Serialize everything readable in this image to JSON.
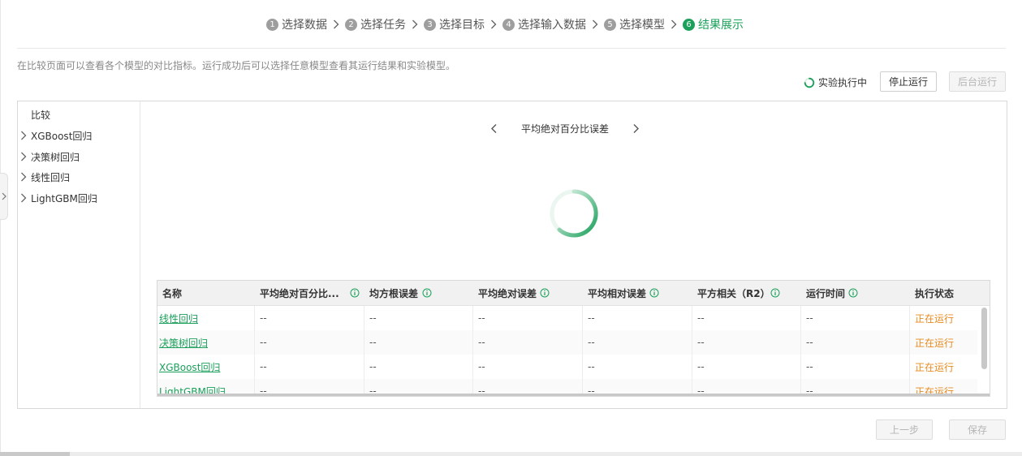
{
  "steps": [
    {
      "num": "1",
      "label": "选择数据"
    },
    {
      "num": "2",
      "label": "选择任务"
    },
    {
      "num": "3",
      "label": "选择目标"
    },
    {
      "num": "4",
      "label": "选择输入数据"
    },
    {
      "num": "5",
      "label": "选择模型"
    },
    {
      "num": "6",
      "label": "结果展示",
      "active": true
    }
  ],
  "hint": "在比较页面可以查看各个模型的对比指标。运行成功后可以选择任意模型查看其运行结果和实验模型。",
  "status": {
    "label": "实验执行中"
  },
  "buttons": {
    "stop": "停止运行",
    "background": "后台运行",
    "prev": "上一步",
    "save": "保存"
  },
  "sidebar": {
    "root": "比较",
    "items": [
      "XGBoost回归",
      "决策树回归",
      "线性回归",
      "LightGBM回归"
    ]
  },
  "metric_nav": {
    "title": "平均绝对百分比误差"
  },
  "table": {
    "columns": [
      "名称",
      "平均绝对百分比...",
      "均方根误差",
      "平均绝对误差",
      "平均相对误差",
      "平方相关（R2）",
      "运行时间",
      "执行状态"
    ],
    "rows": [
      {
        "name": "线性回归",
        "values": [
          "--",
          "--",
          "--",
          "--",
          "--",
          "--"
        ],
        "status": "正在运行"
      },
      {
        "name": "决策树回归",
        "values": [
          "--",
          "--",
          "--",
          "--",
          "--",
          "--"
        ],
        "status": "正在运行"
      },
      {
        "name": "XGBoost回归",
        "values": [
          "--",
          "--",
          "--",
          "--",
          "--",
          "--"
        ],
        "status": "正在运行"
      },
      {
        "name": "LightGBM回归",
        "values": [
          "--",
          "--",
          "--",
          "--",
          "--",
          "--"
        ],
        "status": "正在运行"
      }
    ]
  },
  "colors": {
    "accent": "#1aa05a",
    "running": "#e78a1e"
  }
}
